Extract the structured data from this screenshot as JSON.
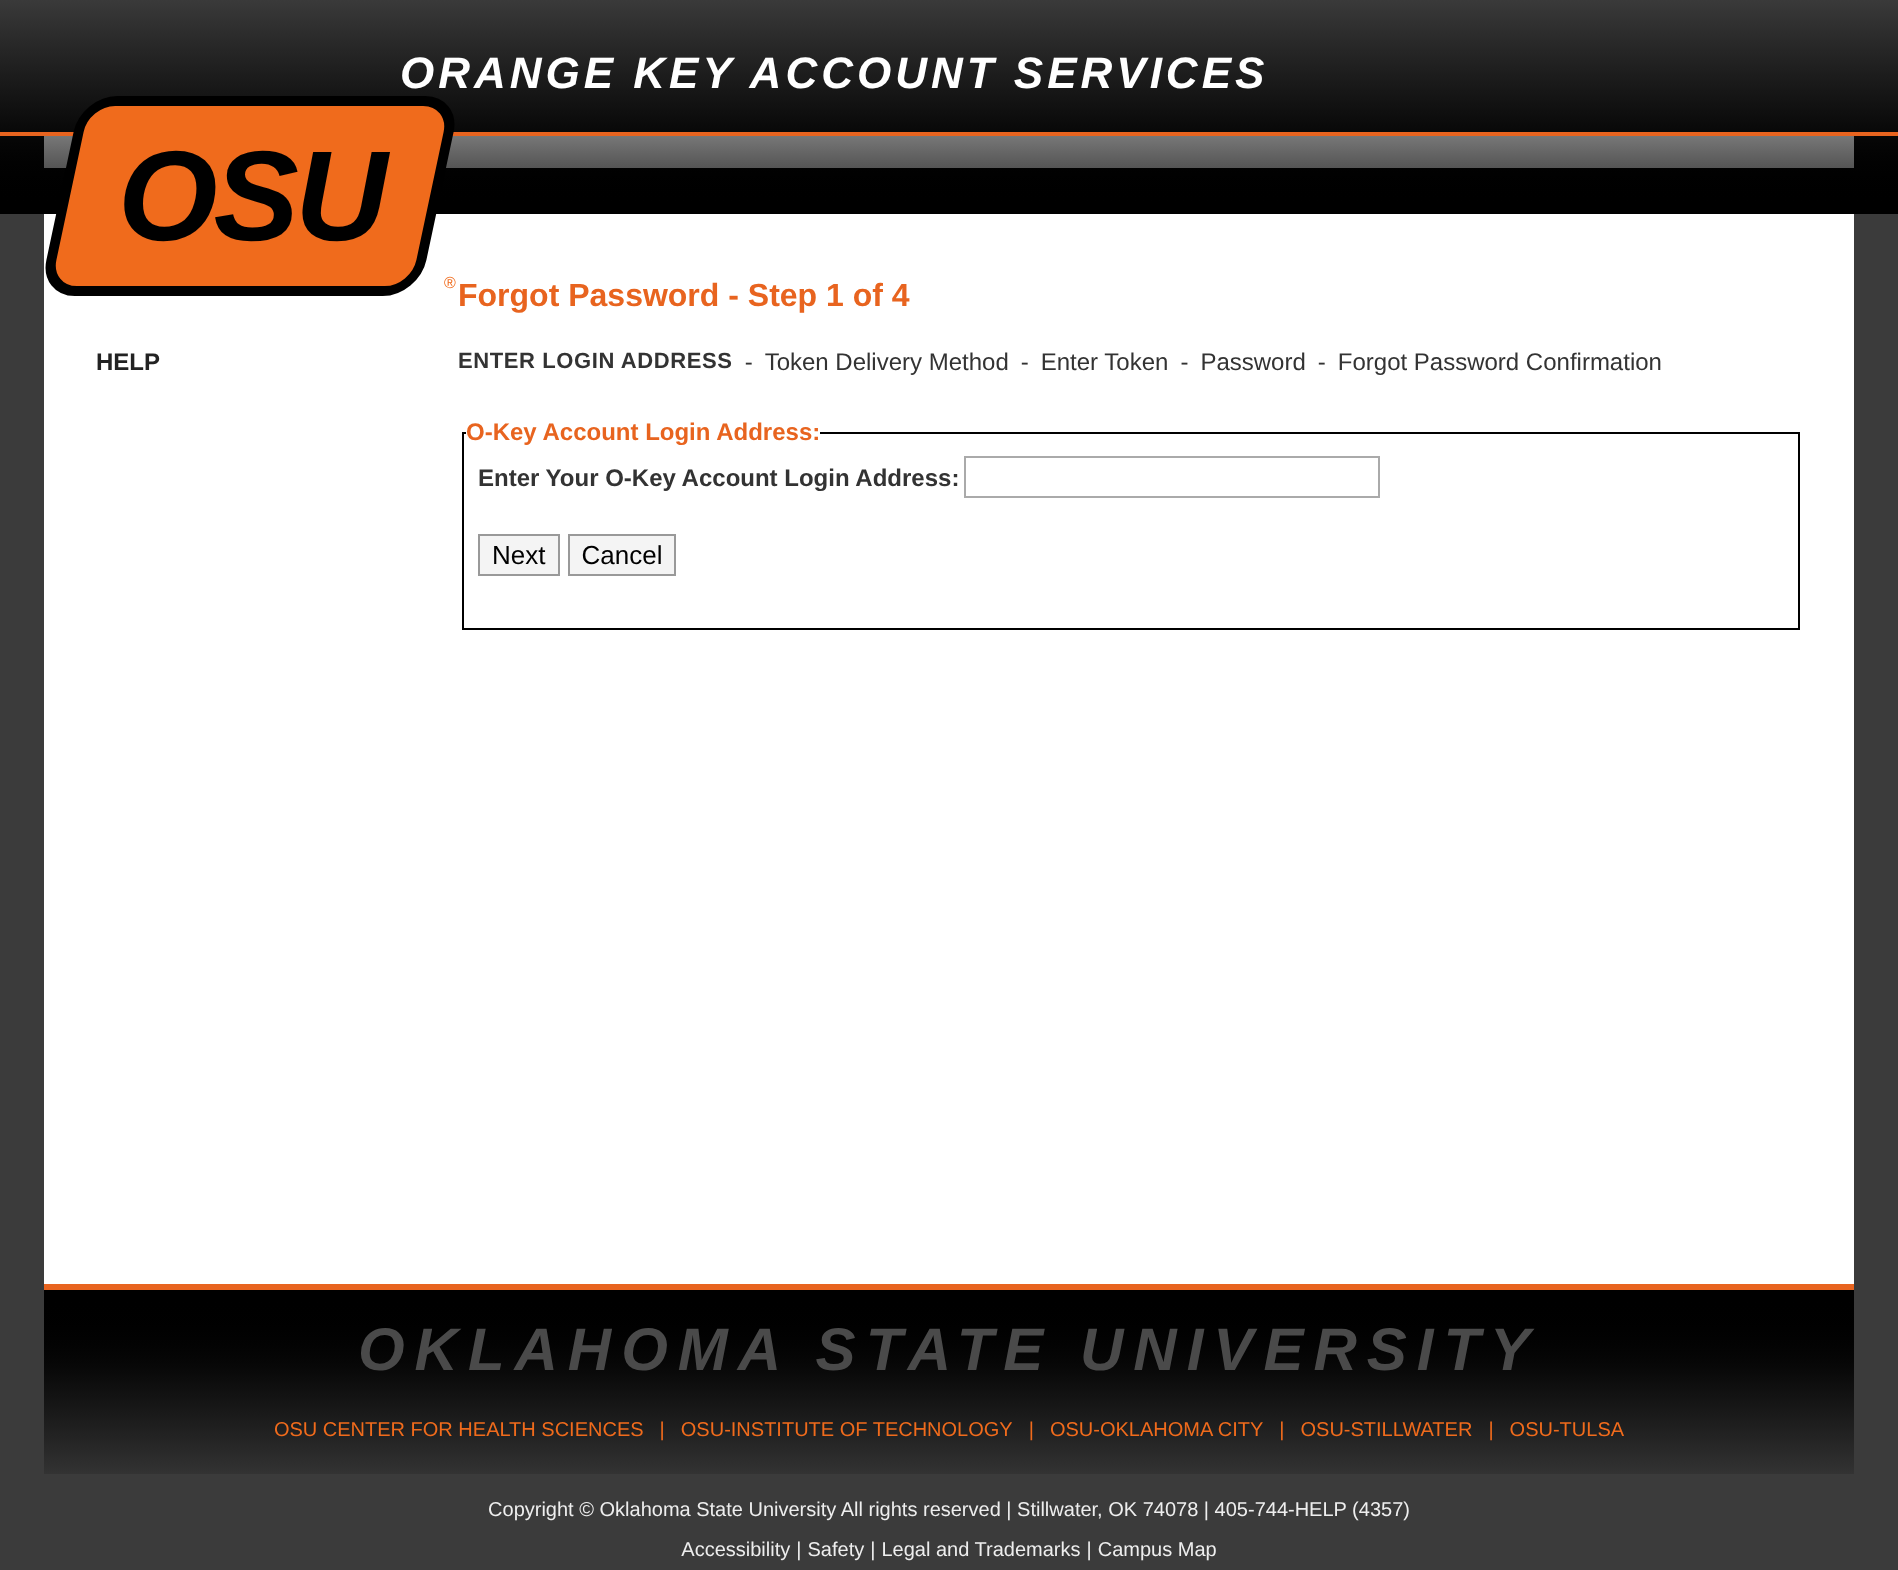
{
  "header": {
    "title": "ORANGE KEY ACCOUNT SERVICES",
    "logo": "OSU",
    "logo_mark": "®"
  },
  "sidebar": {
    "items": [
      "HELP"
    ]
  },
  "page": {
    "title": "Forgot Password - Step 1 of 4",
    "steps": [
      {
        "label": "ENTER LOGIN ADDRESS",
        "selected": true
      },
      {
        "label": "Token Delivery Method",
        "selected": false
      },
      {
        "label": "Enter Token",
        "selected": false
      },
      {
        "label": "Password",
        "selected": false
      },
      {
        "label": "Forgot Password Confirmation",
        "selected": false
      }
    ],
    "step_separator": "-",
    "fieldset": {
      "legend": "O-Key Account Login Address:",
      "label": "Enter Your O-Key Account Login Address:"
    },
    "buttons": [
      "Next",
      "Cancel"
    ]
  },
  "footer": {
    "wordmark": "OKLAHOMA STATE UNIVERSITY",
    "campus_links": [
      "OSU CENTER FOR HEALTH SCIENCES",
      "OSU-INSTITUTE OF TECHNOLOGY",
      "OSU-OKLAHOMA CITY",
      "OSU-STILLWATER",
      "OSU-TULSA"
    ],
    "separator": "|",
    "copyright": "Copyright © Oklahoma State University All rights reserved | Stillwater, OK 74078 | 405-744-HELP (4357)",
    "links": [
      "Accessibility",
      "Safety",
      "Legal and Trademarks",
      "Campus Map"
    ]
  }
}
